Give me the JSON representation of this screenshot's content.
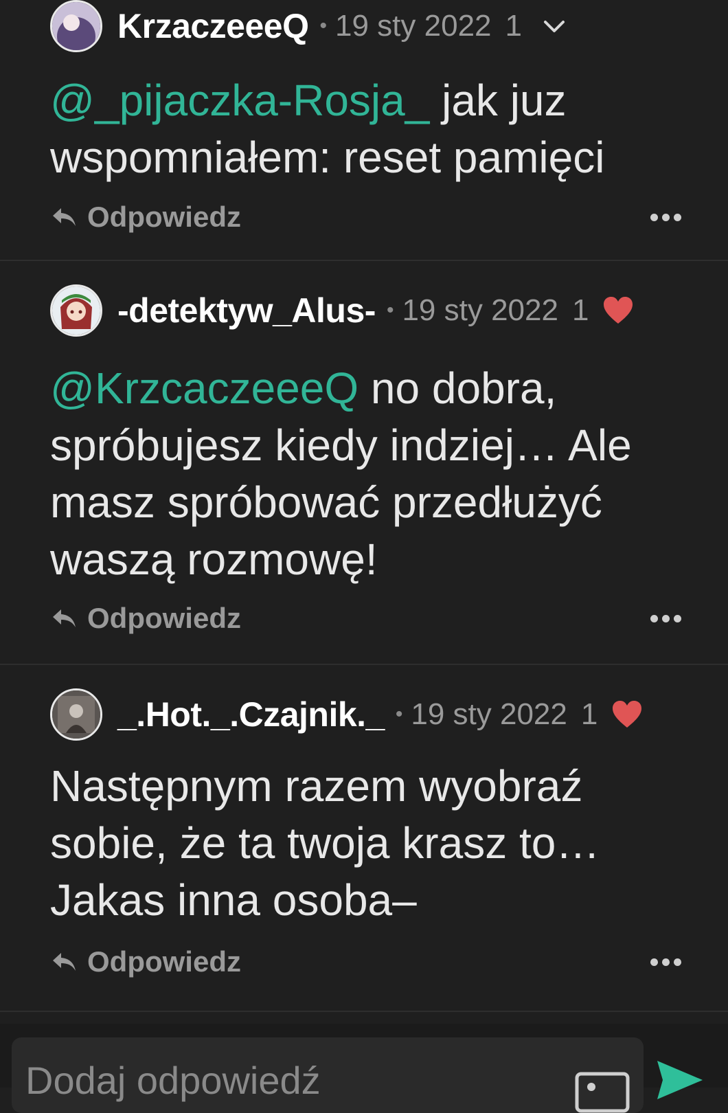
{
  "comments": [
    {
      "username": "KrzaczeeeQ",
      "date": "19 sty 2022",
      "likes": "1",
      "mention": "@_pijaczka-Rosja_",
      "text": " jak juz wspomniałem: reset pamięci",
      "reply_label": "Odpowiedz"
    },
    {
      "username": "-detektyw_Alus-",
      "date": "19 sty 2022",
      "likes": "1",
      "mention": "@KrzcaczeeeQ",
      "text": " no dobra, spróbujesz kiedy indziej… Ale masz spróbować przedłużyć waszą rozmowę!",
      "reply_label": "Odpowiedz"
    },
    {
      "username": "_.Hot._.Czajnik._",
      "date": "19 sty 2022",
      "likes": "1",
      "mention": "",
      "text": "Następnym razem wyobraź sobie, że ta twoja krasz to… Jakas inna osoba–",
      "reply_label": "Odpowiedz"
    }
  ],
  "separator": "•",
  "composer": {
    "placeholder": "Dodaj odpowiedź"
  },
  "colors": {
    "background": "#1f1f1f",
    "mention": "#31b597",
    "heart": "#e05555",
    "send": "#2fbf9a"
  },
  "icons": [
    "chevron-down-icon",
    "heart-icon",
    "reply-icon",
    "more-icon",
    "image-icon",
    "send-icon"
  ]
}
